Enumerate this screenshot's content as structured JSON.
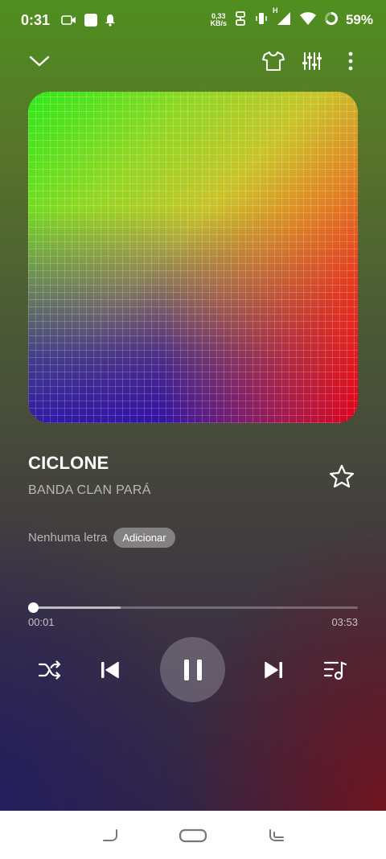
{
  "status_bar": {
    "time": "0:31",
    "net_speed_value": "0,33",
    "net_speed_unit": "KB/s",
    "network_type": "H",
    "battery": "59%"
  },
  "top_bar": {
    "icons": [
      "chevron-down-icon",
      "tshirt-icon",
      "equalizer-icon",
      "more-vertical-icon"
    ]
  },
  "track": {
    "title": "CICLONE",
    "artist": "BANDA CLAN PARÁ",
    "favorite": false
  },
  "lyrics": {
    "status": "Nenhuma letra",
    "add_label": "Adicionar"
  },
  "playback": {
    "elapsed": "00:01",
    "total": "03:53",
    "progress_fraction": 0.004,
    "buffered_fraction": 0.28,
    "state": "playing"
  },
  "controls": [
    "shuffle-icon",
    "previous-icon",
    "pause-icon",
    "next-icon",
    "queue-icon"
  ],
  "colors": {
    "accent": "#ffffff",
    "nav_bar": "#ffffff"
  }
}
